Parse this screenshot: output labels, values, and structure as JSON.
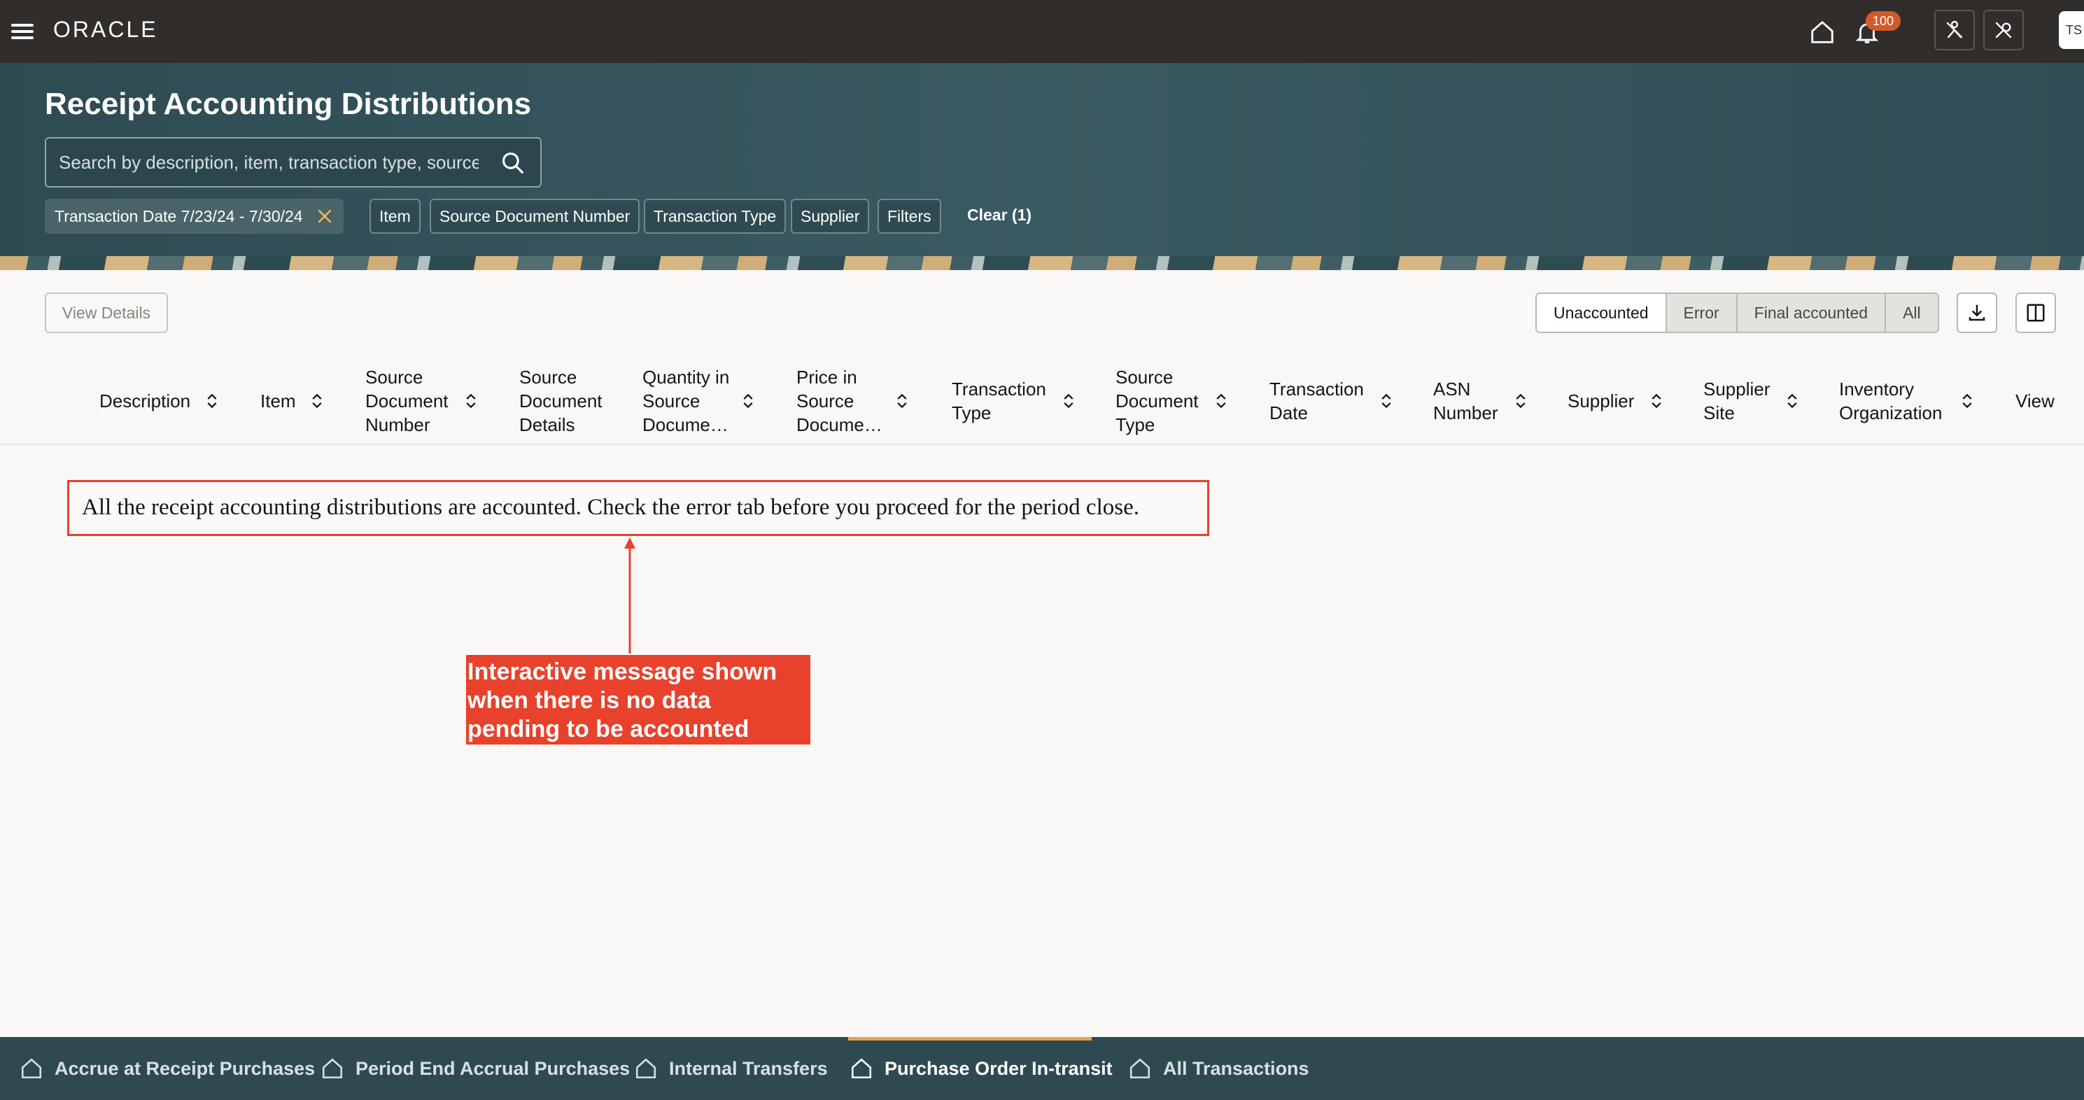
{
  "topbar": {
    "brand": "ORACLE",
    "notification_count": "100",
    "user_initials": "TS"
  },
  "header": {
    "title": "Receipt Accounting Distributions",
    "search_placeholder": "Search by description, item, transaction type, source",
    "filters": {
      "date_chip_label": "Transaction Date 7/23/24 - 7/30/24",
      "item": "Item",
      "source_document_number": "Source Document Number",
      "transaction_type": "Transaction Type",
      "supplier": "Supplier",
      "filters": "Filters",
      "clear": "Clear (1)"
    }
  },
  "toolbar": {
    "view_details": "View Details",
    "status_tabs": [
      "Unaccounted",
      "Error",
      "Final accounted",
      "All"
    ],
    "selected_status": "Unaccounted"
  },
  "table": {
    "columns": [
      "Description",
      "Item",
      "Source Document Number",
      "Source Document Details",
      "Quantity in Source Docume…",
      "Price in Source Docume…",
      "Transaction Type",
      "Source Document Type",
      "Transaction Date",
      "ASN Number",
      "Supplier",
      "Supplier Site",
      "Inventory Organization",
      "View"
    ]
  },
  "message": {
    "text": "All the receipt accounting distributions are accounted. Check the error tab before you proceed for the period close."
  },
  "annotation": {
    "callout_lines": [
      "Interactive message shown",
      "when there is no data",
      "pending to be accounted"
    ],
    "color": "#e8412c"
  },
  "bottom_nav": {
    "items": [
      "Accrue at Receipt Purchases",
      "Period End Accrual Purchases",
      "Internal Transfers",
      "Purchase Order In-transit",
      "All Transactions"
    ],
    "active": "Purchase Order In-transit"
  },
  "colors": {
    "topbar": "#312d2a",
    "header": "#2e4b52",
    "accent": "#e0a64d",
    "annotation_red": "#e44132"
  }
}
